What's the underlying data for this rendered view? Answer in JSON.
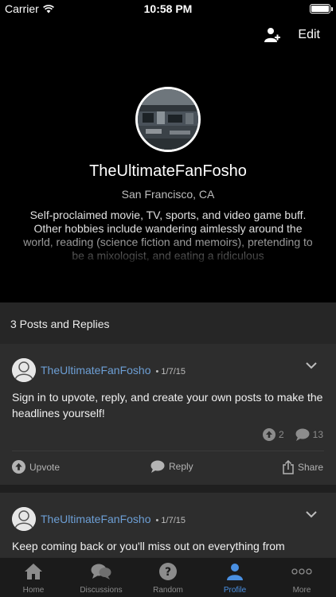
{
  "status_bar": {
    "carrier": "Carrier",
    "time": "10:58 PM",
    "battery_level": 1.0
  },
  "header": {
    "edit_label": "Edit",
    "add_user_icon": "add-user-icon"
  },
  "profile": {
    "username": "TheUltimateFanFosho",
    "location": "San Francisco, CA",
    "bio": "Self-proclaimed movie, TV, sports, and video game buff. Other hobbies include wandering aimlessly around the world, reading (science fiction and memoirs), pretending to be a mixologist, and eating a ridiculous"
  },
  "posts_section": {
    "count_label": "3 Posts and Replies"
  },
  "posts": [
    {
      "author": "TheUltimateFanFosho",
      "date": "• 1/7/15",
      "text": "Sign in to upvote, reply, and create your own posts to make the headlines yourself!",
      "upvotes": "2",
      "comments": "13",
      "actions": {
        "upvote": "Upvote",
        "reply": "Reply",
        "share": "Share"
      }
    },
    {
      "author": "TheUltimateFanFosho",
      "date": "• 1/7/15",
      "text": "Keep coming back or you'll miss out on everything from"
    }
  ],
  "tab_bar": {
    "tabs": [
      {
        "label": "Home",
        "icon": "home-icon"
      },
      {
        "label": "Discussions",
        "icon": "chat-bubbles-icon"
      },
      {
        "label": "Random",
        "icon": "question-icon"
      },
      {
        "label": "Profile",
        "icon": "person-icon"
      },
      {
        "label": "More",
        "icon": "ellipsis-icon"
      }
    ],
    "active": "Profile",
    "active_color": "#4a90e2"
  },
  "colors": {
    "author_link": "#6d9fd5",
    "accent": "#4a90e2",
    "background": "#1f1f1f"
  }
}
